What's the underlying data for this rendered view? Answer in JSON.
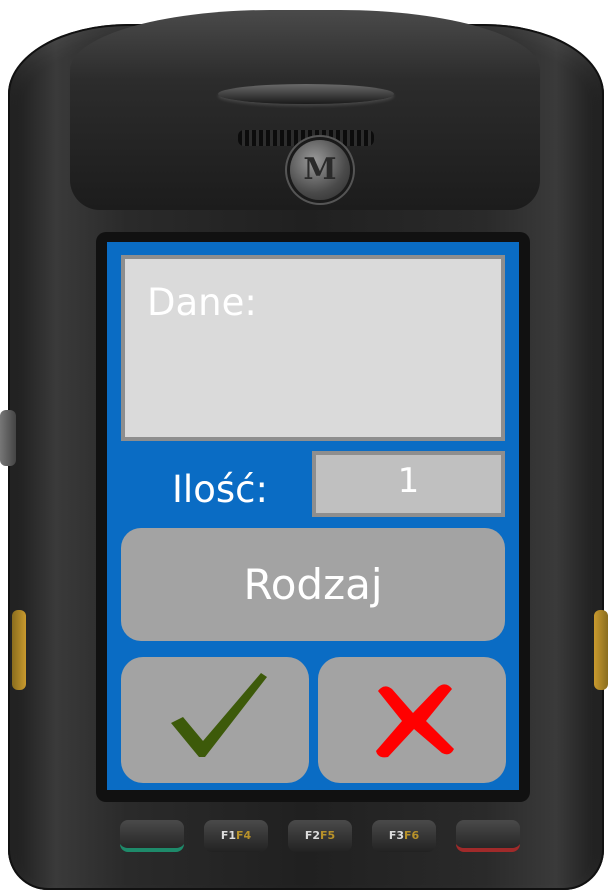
{
  "device": {
    "logo_letter": "M"
  },
  "screen": {
    "data_label": "Dane:",
    "quantity_label": "Ilość:",
    "quantity_value": "1",
    "type_button_label": "Rodzaj",
    "confirm_icon": "checkmark-icon",
    "cancel_icon": "cross-icon"
  },
  "keys": {
    "f1": "F1",
    "f1_sub": "F4",
    "f2": "F2",
    "f2_sub": "F5",
    "f3": "F3",
    "f3_sub": "F6"
  },
  "colors": {
    "screen_bg": "#0a6cc4",
    "button_bg": "#a3a3a3",
    "confirm": "#3d5a0a",
    "cancel": "#ff0000"
  }
}
